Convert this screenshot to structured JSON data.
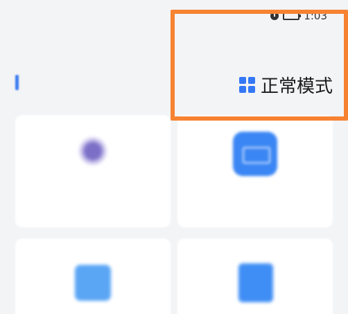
{
  "status_bar": {
    "left_text": "",
    "time": "1:03",
    "icons": [
      "alarm-icon",
      "battery-icon"
    ]
  },
  "section": {
    "title": ""
  },
  "mode_toggle": {
    "label": "正常模式",
    "icon": "grid-icon"
  },
  "cards": [
    {
      "label": "",
      "icon": "round-icon"
    },
    {
      "label": "",
      "icon": "id-card-icon"
    },
    {
      "label": "",
      "icon": "scan-icon"
    },
    {
      "label": "",
      "icon": "document-icon"
    }
  ],
  "colors": {
    "accent": "#3478f6",
    "highlight": "#f78231",
    "background": "#f3f4f6",
    "card": "#ffffff"
  }
}
